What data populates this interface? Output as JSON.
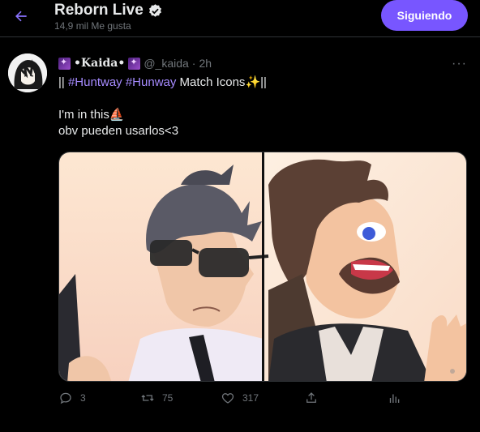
{
  "header": {
    "title": "Reborn Live",
    "likes_subtitle": "14,9 mil Me gusta",
    "follow_label": "Siguiendo"
  },
  "tweet": {
    "author_name": "•Kaida•",
    "author_handle": "@_kaida",
    "separator": "·",
    "time": "2h",
    "text_line1_prefix": "|| ",
    "hashtag1": "#Huntway",
    "hashtag2": "#Hunway",
    "text_line1_mid": " Match Icons",
    "sparkle": "✨",
    "text_line1_suffix": "||",
    "text_line2": "I'm in this",
    "boat": "⛵",
    "text_line3": "obv pueden usarlos<3",
    "more_label": "···"
  },
  "actions": {
    "reply_count": "3",
    "retweet_count": "75",
    "like_count": "317"
  },
  "colors": {
    "accent": "#7856ff",
    "hashtag": "#a68bff",
    "muted": "#71767b",
    "background": "#000000"
  },
  "icons": [
    "back-arrow-icon",
    "verified-badge-icon",
    "more-icon",
    "reply-icon",
    "retweet-icon",
    "like-icon",
    "share-icon",
    "analytics-icon"
  ]
}
